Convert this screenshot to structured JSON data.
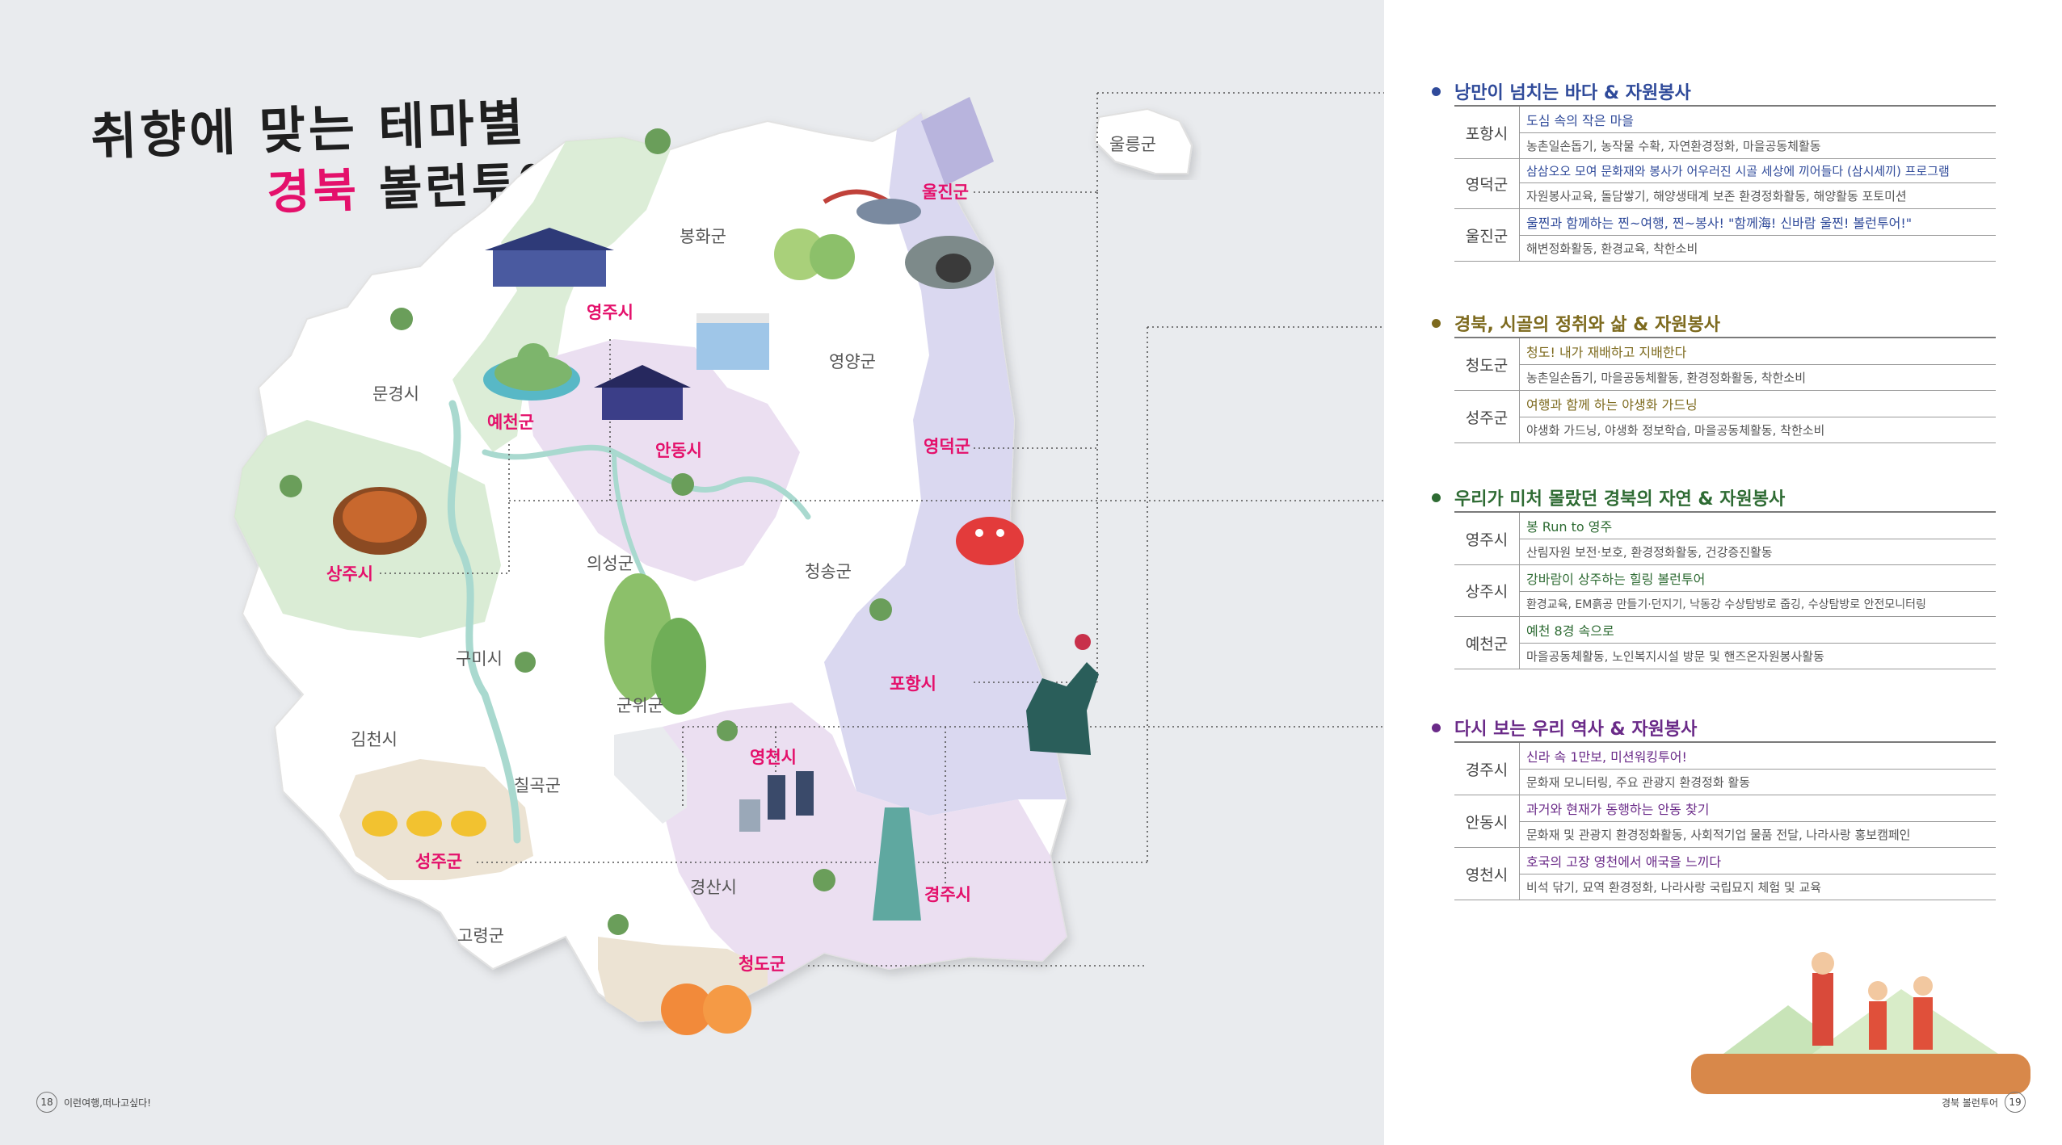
{
  "title": {
    "line1": "취향에 맞는 테마별",
    "line2_highlight": "경북",
    "line2_rest": " 볼런투어!"
  },
  "colors": {
    "theme1": "#2f4a9a",
    "theme2": "#7d6a1e",
    "theme3": "#2e6b33",
    "theme4": "#6a2a88",
    "accent": "#e4106b"
  },
  "map": {
    "regions": [
      "봉화군",
      "영양군",
      "문경시",
      "의성군",
      "청송군",
      "구미시",
      "군위군",
      "김천시",
      "칠곡군",
      "경산시",
      "고령군",
      "울릉군"
    ],
    "theme_regions": [
      "울진군",
      "영주시",
      "예천군",
      "안동시",
      "영덕군",
      "상주시",
      "포항시",
      "영천시",
      "성주군",
      "경주시",
      "청도군"
    ]
  },
  "sections": [
    {
      "title": "낭만이 넘치는 바다 & 자원봉사",
      "rows": [
        {
          "area": "포항시",
          "program": "도심 속의 작은 마을",
          "activities": "농촌일손돕기, 농작물 수확, 자연환경정화, 마을공동체활동"
        },
        {
          "area": "영덕군",
          "program": "삼삼오오 모여 문화재와 봉사가 어우러진 시골 세상에 끼어들다 (삼시세끼) 프로그램",
          "activities": "자원봉사교육, 돌담쌓기, 해양생태계 보존 환경정화활동, 해양활동 포토미션"
        },
        {
          "area": "울진군",
          "program": "울찐과 함께하는 찐~여행, 찐~봉사! \"함께海! 신바람 울찐! 볼런투어!\"",
          "activities": "해변정화활동, 환경교육, 착한소비"
        }
      ]
    },
    {
      "title": "경북, 시골의 정취와 삶 & 자원봉사",
      "rows": [
        {
          "area": "청도군",
          "program": "청도! 내가 재배하고 지배한다",
          "activities": "농촌일손돕기, 마을공동체활동, 환경정화활동, 착한소비"
        },
        {
          "area": "성주군",
          "program": "여행과 함께 하는 야생화 가드닝",
          "activities": "야생화 가드닝, 야생화 정보학습, 마을공동체활동, 착한소비"
        }
      ]
    },
    {
      "title": "우리가 미처 몰랐던 경북의 자연 & 자원봉사",
      "rows": [
        {
          "area": "영주시",
          "program": "봉 Run to 영주",
          "activities": "산림자원 보전·보호, 환경정화활동, 건강증진활동"
        },
        {
          "area": "상주시",
          "program": "강바람이 상주하는 힐링 볼런투어",
          "activities": "환경교육, EM흙공 만들기·던지기, 낙동강 수상탐방로 줍깅, 수상탐방로 안전모니터링"
        },
        {
          "area": "예천군",
          "program": "예천 8경 속으로",
          "activities": "마을공동체활동, 노인복지시설 방문 및 핸즈온자원봉사활동"
        }
      ]
    },
    {
      "title": "다시 보는 우리 역사 & 자원봉사",
      "rows": [
        {
          "area": "경주시",
          "program": "신라 속 1만보, 미션워킹투어!",
          "activities": "문화재 모니터링, 주요 관광지 환경정화 활동"
        },
        {
          "area": "안동시",
          "program": "과거와 현재가 동행하는 안동 찾기",
          "activities": "문화재 및 관광지 환경정화활동, 사회적기업 물품 전달, 나라사랑 홍보캠페인"
        },
        {
          "area": "영천시",
          "program": "호국의 고장 영천에서 애국을 느끼다",
          "activities": "비석 닦기, 묘역 환경정화, 나라사랑 국립묘지 체험 및 교육"
        }
      ]
    }
  ],
  "footer": {
    "left_page": "18",
    "left_text": "이런여행,떠나고싶다!",
    "right_text": "경북 볼런투어",
    "right_page": "19"
  }
}
